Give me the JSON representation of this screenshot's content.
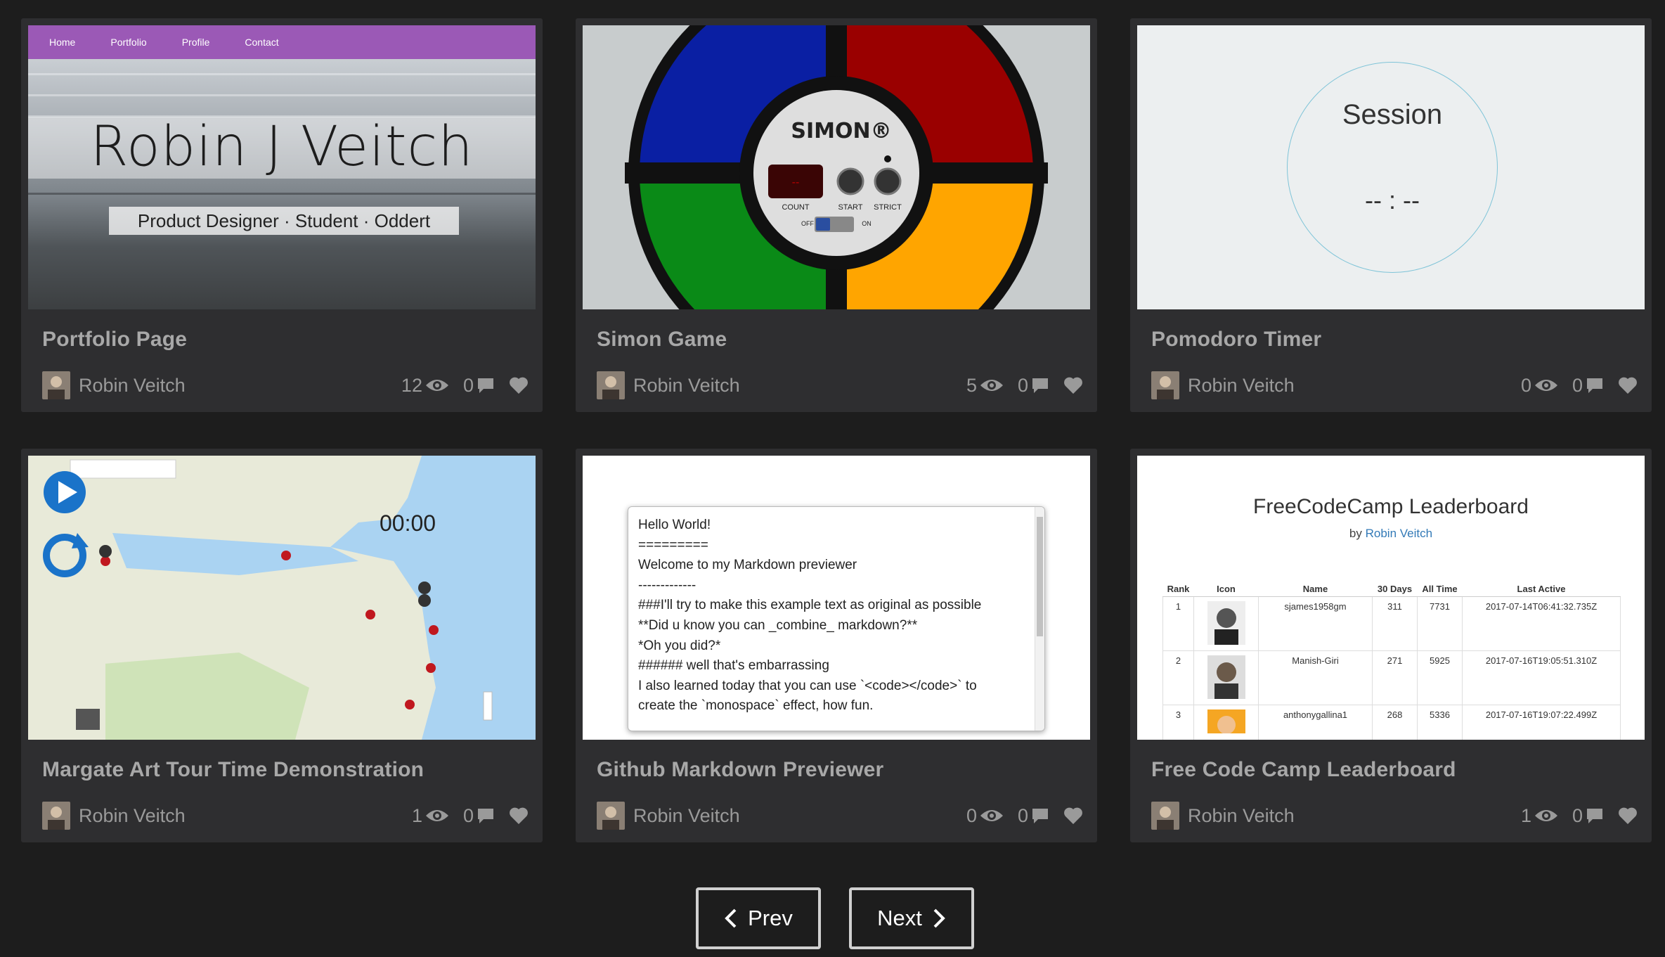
{
  "cards": [
    {
      "title": "Portfolio Page",
      "author": "Robin Veitch",
      "views": "12",
      "comments": "0"
    },
    {
      "title": "Simon Game",
      "author": "Robin Veitch",
      "views": "5",
      "comments": "0"
    },
    {
      "title": "Pomodoro Timer",
      "author": "Robin Veitch",
      "views": "0",
      "comments": "0"
    },
    {
      "title": "Margate Art Tour Time Demonstration",
      "author": "Robin Veitch",
      "views": "1",
      "comments": "0"
    },
    {
      "title": "Github Markdown Previewer",
      "author": "Robin Veitch",
      "views": "0",
      "comments": "0"
    },
    {
      "title": "Free Code Camp Leaderboard",
      "author": "Robin Veitch",
      "views": "1",
      "comments": "0"
    }
  ],
  "portfolio": {
    "nav": [
      "Home",
      "Portfolio",
      "Profile",
      "Contact"
    ],
    "name": "Robin J Veitch",
    "subtitle": "Product Designer  ·  Student  ·  Oddert"
  },
  "simon": {
    "brand": "SIMON®",
    "count_display": "--",
    "count_label": "COUNT",
    "start_label": "START",
    "strict_label": "STRICT",
    "off_label": "OFF",
    "on_label": "ON"
  },
  "pomodoro": {
    "label": "Session",
    "time": "-- : --"
  },
  "map": {
    "time": "00:00"
  },
  "markdown": {
    "lines": [
      "Hello World!",
      "=========",
      "Welcome to my Markdown previewer",
      "-------------",
      "###I'll try to make this example text as original as possible",
      "**Did u know you can _combine_ markdown?**",
      "*Oh you did?*",
      "###### well that's embarrassing",
      "I also learned today that you can use `<code></code>` to",
      "create the `monospace` effect, how fun."
    ]
  },
  "leaderboard": {
    "title": "FreeCodeCamp Leaderboard",
    "by": "by",
    "author": "Robin Veitch",
    "headers": [
      "Rank",
      "Icon",
      "Name",
      "30 Days",
      "All Time",
      "Last Active"
    ],
    "rows": [
      [
        "1",
        "",
        "sjames1958gm",
        "311",
        "7731",
        "2017-07-14T06:41:32.735Z"
      ],
      [
        "2",
        "",
        "Manish-Giri",
        "271",
        "5925",
        "2017-07-16T19:05:51.310Z"
      ],
      [
        "3",
        "",
        "anthonygallina1",
        "268",
        "5336",
        "2017-07-16T19:07:22.499Z"
      ]
    ]
  },
  "pagination": {
    "prev": "Prev",
    "next": "Next"
  },
  "colors": {
    "background": "#1d1d1d",
    "card": "#2e2e30",
    "portfolio_nav": "#9b59b6",
    "simon_blue": "#0a1fa3",
    "simon_red": "#9a0000",
    "simon_green": "#0a8a17",
    "simon_yellow": "#ffa500"
  }
}
